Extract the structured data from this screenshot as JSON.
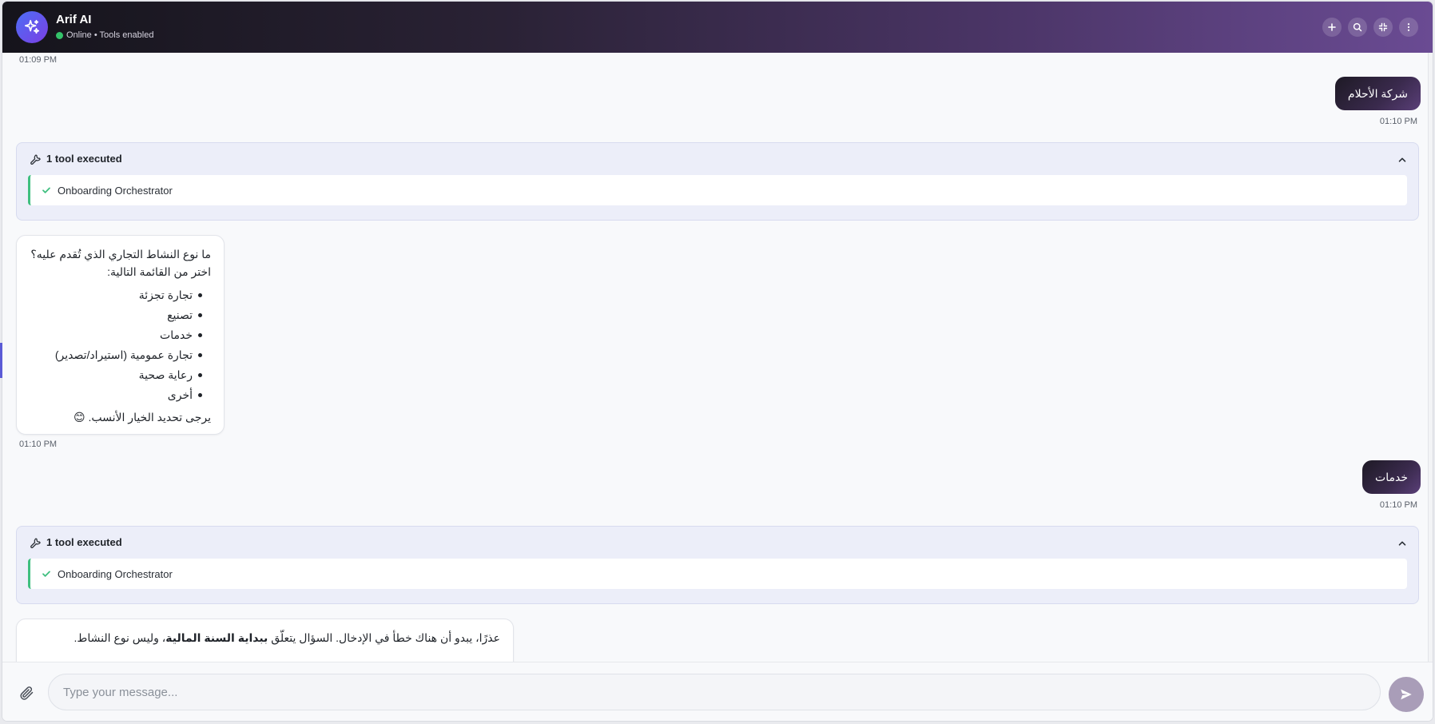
{
  "header": {
    "title": "Arif AI",
    "status": "Online • Tools enabled",
    "buttons": [
      "new-chat",
      "search",
      "collapse",
      "more"
    ]
  },
  "messages": {
    "top_timestamp": "01:09 PM",
    "user1": {
      "text": "شركة الأحلام",
      "time": "01:10 PM"
    },
    "tool1": {
      "summary": "1 tool executed",
      "item": "Onboarding Orchestrator"
    },
    "bot1": {
      "question": "ما نوع النشاط التجاري الذي تُقدم عليه؟",
      "intro": "اختر من القائمة التالية:",
      "options": [
        "تجارة تجزئة",
        "تصنيع",
        "خدمات",
        "تجارة عمومية (استيراد/تصدير)",
        "رعاية صحية",
        "أخرى"
      ],
      "closing": "يرجى تحديد الخيار الأنسب. 😊",
      "time": "01:10 PM"
    },
    "user2": {
      "text": "خدمات",
      "time": "01:10 PM"
    },
    "tool2": {
      "summary": "1 tool executed",
      "item": "Onboarding Orchestrator"
    },
    "bot2": {
      "part1": "عذرًا، يبدو أن هناك خطأ في الإدخال. السؤال يتعلّق ",
      "bold": "ببداية السنة المالية",
      "part2": "، وليس نوع النشاط."
    }
  },
  "composer": {
    "placeholder": "Type your message..."
  },
  "colors": {
    "header_start": "#15141b",
    "header_end": "#6a4b93",
    "online": "#34c26a",
    "tool_success": "#3fbf7f",
    "send_button": "#a99db8"
  }
}
